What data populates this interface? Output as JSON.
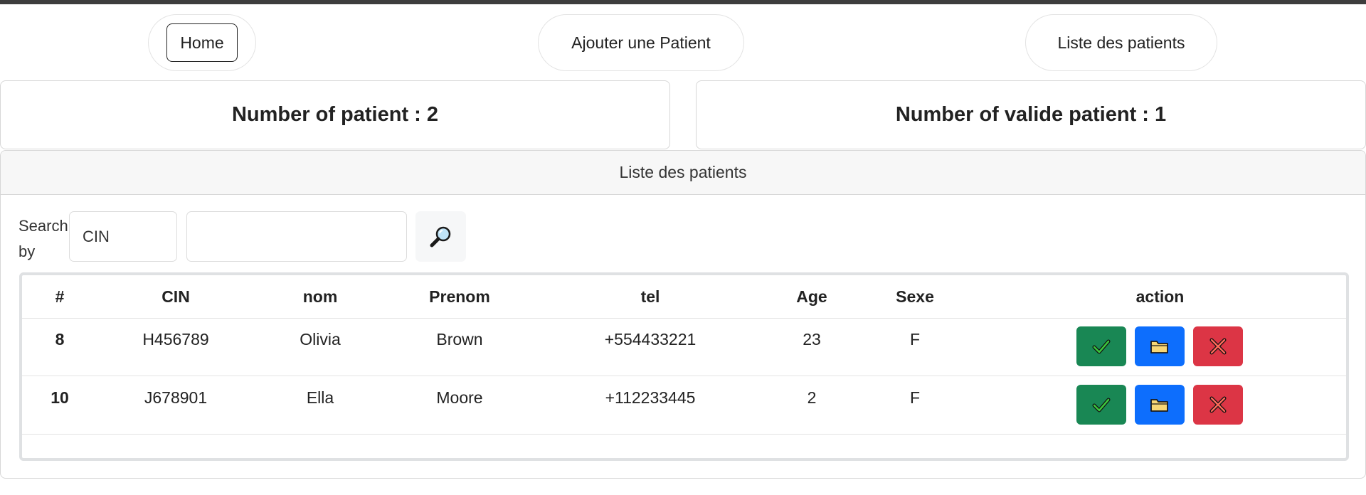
{
  "nav": {
    "home_label": "Home",
    "add_label": "Ajouter une Patient",
    "list_label": "Liste des patients"
  },
  "stats": {
    "total": "Number of patient : 2",
    "valid": "Number of valide patient : 1"
  },
  "card": {
    "title": "Liste des patients"
  },
  "search": {
    "label": "Search by",
    "field_value": "CIN",
    "query_value": "",
    "button_icon": "magnifier-icon"
  },
  "table": {
    "headers": [
      "#",
      "CIN",
      "nom",
      "Prenom",
      "tel",
      "Age",
      "Sexe",
      "action"
    ],
    "rows": [
      {
        "id": "8",
        "cin": "H456789",
        "nom": "Olivia",
        "prenom": "Brown",
        "tel": "+554433221",
        "age": "23",
        "sexe": "F"
      },
      {
        "id": "10",
        "cin": "J678901",
        "nom": "Ella",
        "prenom": "Moore",
        "tel": "+112233445",
        "age": "2",
        "sexe": "F"
      }
    ],
    "action_icons": [
      "check-icon",
      "folder-icon",
      "cross-icon"
    ]
  },
  "colors": {
    "validate": "#198754",
    "open": "#0d6efd",
    "delete": "#dc3545"
  }
}
